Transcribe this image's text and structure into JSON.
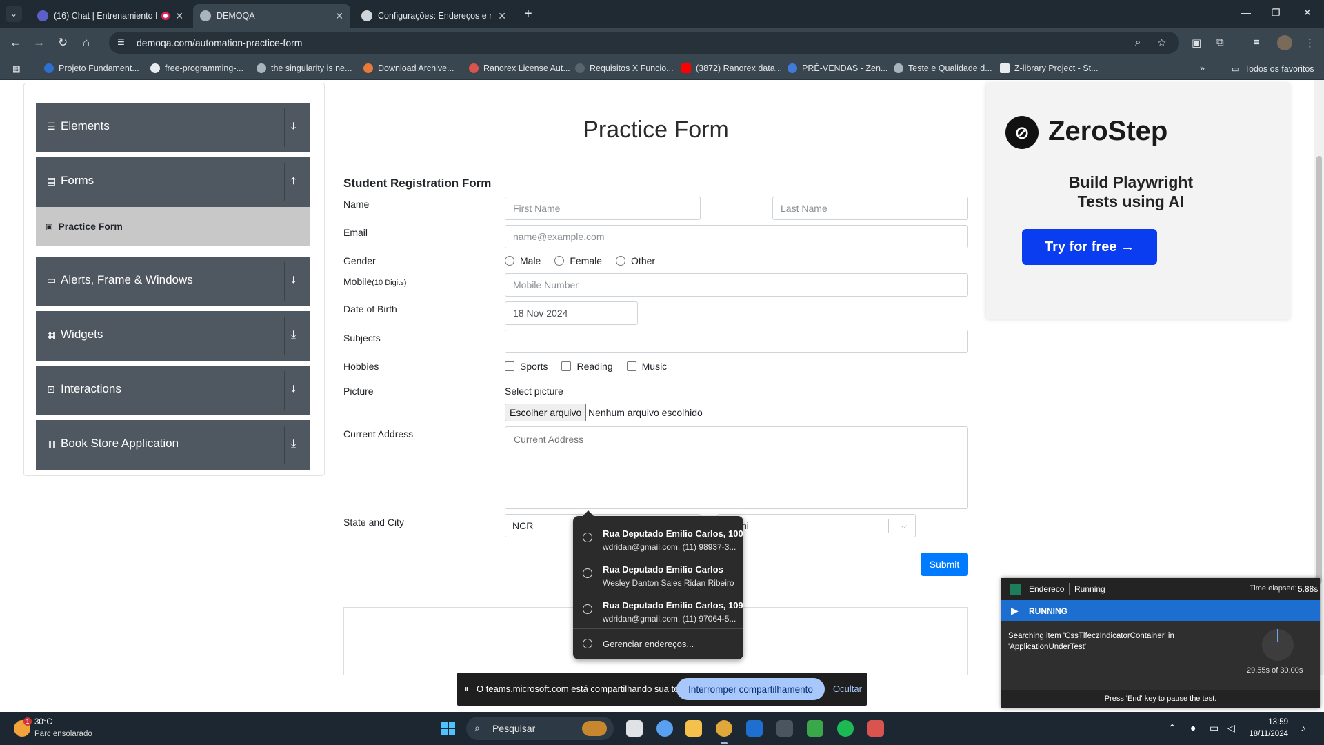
{
  "browser": {
    "tabs": [
      {
        "title": "(16) Chat | Entrenamiento R",
        "favicon_color": "#5b5fc7"
      },
      {
        "title": "DEMOQA",
        "favicon_color": "#aab4bd"
      },
      {
        "title": "Configurações: Endereços e ma",
        "favicon_color": "#cfd4d8"
      }
    ],
    "url": "demoqa.com/automation-practice-form",
    "bookmarks": [
      "Projeto Fundament...",
      "free-programming-...",
      "the singularity is ne...",
      "Download Archive...",
      "Ranorex License Aut...",
      "Requisitos X Funcio...",
      "(3872) Ranorex data...",
      "PRÉ-VENDAS - Zen...",
      "Teste e Qualidade d...",
      "Z-library Project - St..."
    ],
    "bookmarks_folder": "Todos os favoritos"
  },
  "sidebar": {
    "groups": [
      {
        "label": "Elements",
        "arrow": "⤓"
      },
      {
        "label": "Forms",
        "arrow": "⤒"
      },
      {
        "label": "Alerts, Frame & Windows",
        "arrow": "⤓"
      },
      {
        "label": "Widgets",
        "arrow": "⤓"
      },
      {
        "label": "Interactions",
        "arrow": "⤓"
      },
      {
        "label": "Book Store Application",
        "arrow": "⤓"
      }
    ],
    "active_item": "Practice Form"
  },
  "form": {
    "title": "Practice Form",
    "subtitle": "Student Registration Form",
    "labels": {
      "name": "Name",
      "email": "Email",
      "gender": "Gender",
      "mobile": "Mobile",
      "mobile_hint": "(10 Digits)",
      "dob": "Date of Birth",
      "subjects": "Subjects",
      "hobbies": "Hobbies",
      "picture": "Picture",
      "address": "Current Address",
      "state_city": "State and City"
    },
    "placeholders": {
      "first_name": "First Name",
      "last_name": "Last Name",
      "email": "name@example.com",
      "mobile": "Mobile Number",
      "address": "Current Address"
    },
    "dob_value": "18 Nov 2024",
    "gender_options": [
      "Male",
      "Female",
      "Other"
    ],
    "hobby_options": [
      "Sports",
      "Reading",
      "Music"
    ],
    "select_picture": "Select picture",
    "file_button": "Escolher arquivo",
    "file_status": "Nenhum arquivo escolhido",
    "state_value": "NCR",
    "city_value": "hi",
    "submit": "Submit"
  },
  "autofill": {
    "suggestions": [
      {
        "line1": "Rua Deputado Emilio Carlos, 100",
        "line2": "wdridan@gmail.com, (11) 98937-3..."
      },
      {
        "line1": "Rua Deputado Emilio Carlos",
        "line2": "Wesley Danton Sales Ridan Ribeiro"
      },
      {
        "line1": "Rua Deputado Emilio Carlos, 109",
        "line2": "wdridan@gmail.com, (11) 97064-5..."
      }
    ],
    "manage": "Gerenciar endereços..."
  },
  "ad": {
    "brand": "ZeroStep",
    "headline_1": "Build Playwright",
    "headline_2": "Tests using AI",
    "cta": "Try for free →"
  },
  "share_bar": {
    "message": "O teams.microsoft.com está compartilhando sua tela.",
    "stop": "Interromper compartilhamento",
    "hide": "Ocultar"
  },
  "runner": {
    "name": "Endereco",
    "status": "Running",
    "elapsed_label": "Time elapsed:",
    "elapsed": "5.88s",
    "bar_label": "RUNNING",
    "message": "Searching item 'CssTlfeczIndicatorContainer' in 'ApplicationUnderTest'",
    "counter": "29.55s of 30.00s",
    "footer": "Press 'End' key to pause the test."
  },
  "taskbar": {
    "temperature": "30°C",
    "weather": "Parc ensolarado",
    "weather_badge": "1",
    "search": "Pesquisar",
    "time": "13:59",
    "date": "18/11/2024"
  }
}
